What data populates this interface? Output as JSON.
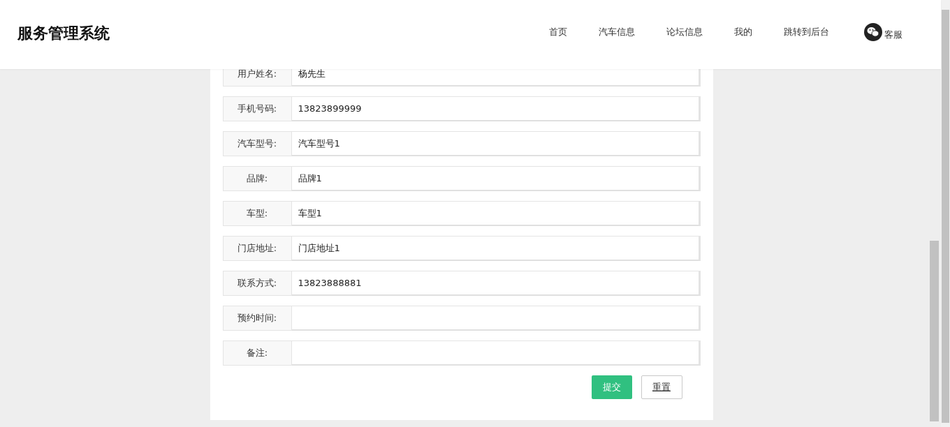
{
  "header": {
    "title": "服务管理系统",
    "nav": [
      {
        "label": "首页",
        "kind": "link"
      },
      {
        "label": "汽车信息",
        "kind": "link"
      },
      {
        "label": "论坛信息",
        "kind": "link"
      },
      {
        "label": "我的",
        "kind": "link"
      },
      {
        "label": "跳转到后台",
        "kind": "link"
      },
      {
        "label": "客服",
        "kind": "chat"
      }
    ]
  },
  "form": {
    "fields": [
      {
        "label": "用户姓名:",
        "value": "杨先生"
      },
      {
        "label": "手机号码:",
        "value": "13823899999"
      },
      {
        "label": "汽车型号:",
        "value": "汽车型号1"
      },
      {
        "label": "品牌:",
        "value": "品牌1"
      },
      {
        "label": "车型:",
        "value": "车型1"
      },
      {
        "label": "门店地址:",
        "value": "门店地址1"
      },
      {
        "label": "联系方式:",
        "value": "13823888881"
      },
      {
        "label": "预约时间:"
      },
      {
        "label": "备注:"
      }
    ],
    "buttons": [
      {
        "label": "提交",
        "kind": "primary"
      },
      {
        "label": "重置",
        "kind": "secondary"
      }
    ]
  }
}
